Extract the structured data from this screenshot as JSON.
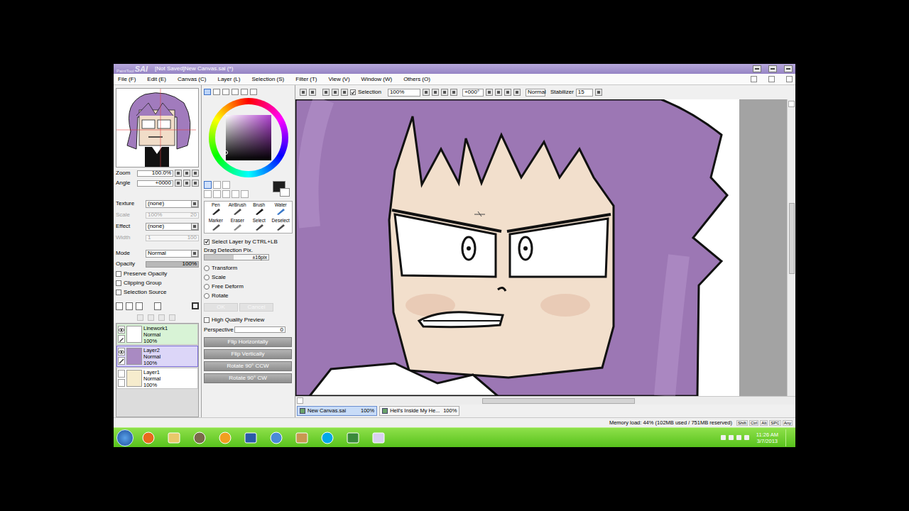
{
  "window": {
    "logo_small": "PaintTool",
    "logo_big": "SAI",
    "title": "[Not Saved]New Canvas.sai (*)"
  },
  "menu": [
    "File (F)",
    "Edit (E)",
    "Canvas (C)",
    "Layer (L)",
    "Selection (S)",
    "Filter (T)",
    "View (V)",
    "Window (W)",
    "Others (O)"
  ],
  "navigator": {
    "zoom": {
      "label": "Zoom",
      "value": "100.0%"
    },
    "angle": {
      "label": "Angle",
      "value": "+0000"
    }
  },
  "brush_settings": [
    {
      "label": "Texture",
      "value": "(none)",
      "extra": "",
      "disabled": false,
      "kind": "select"
    },
    {
      "label": "Scale",
      "value": "100%",
      "extra": "20",
      "disabled": true,
      "kind": "slider"
    },
    {
      "label": "Effect",
      "value": "(none)",
      "extra": "",
      "disabled": false,
      "kind": "select"
    },
    {
      "label": "Width",
      "value": "1",
      "extra": "100",
      "disabled": true,
      "kind": "slider"
    }
  ],
  "mode": {
    "label": "Mode",
    "value": "Normal"
  },
  "opacity": {
    "label": "Opacity",
    "value": "100%",
    "level": 1
  },
  "layer_options": [
    {
      "label": "Preserve Opacity",
      "checked": false
    },
    {
      "label": "Clipping Group",
      "checked": false
    },
    {
      "label": "Selection Source",
      "checked": false
    }
  ],
  "layers": [
    {
      "name": "Linework1",
      "mode": "Normal",
      "opacity": "100%",
      "visible": true,
      "selected": false,
      "kind": "linework"
    },
    {
      "name": "Layer2",
      "mode": "Normal",
      "opacity": "100%",
      "visible": true,
      "selected": true,
      "kind": "normal"
    },
    {
      "name": "Layer1",
      "mode": "Normal",
      "opacity": "100%",
      "visible": false,
      "selected": false,
      "kind": "normal"
    }
  ],
  "tools": [
    {
      "label": "Pen"
    },
    {
      "label": "AirBrush"
    },
    {
      "label": "Brush"
    },
    {
      "label": "Water"
    },
    {
      "label": "Marker"
    },
    {
      "label": "Eraser"
    },
    {
      "label": "Select"
    },
    {
      "label": "Deselect"
    }
  ],
  "transform": {
    "select_layer": {
      "label": "Select Layer by CTRL+LB",
      "checked": true
    },
    "drag": {
      "label": "Drag Detection Pix.",
      "value": "±16pix",
      "level": 0.45
    },
    "modes": [
      {
        "label": "Transform",
        "selected": false
      },
      {
        "label": "Scale",
        "selected": false
      },
      {
        "label": "Free Deform",
        "selected": false
      },
      {
        "label": "Rotate",
        "selected": false
      }
    ],
    "confirm": [
      {
        "label": "OK",
        "disabled": true
      },
      {
        "label": "Cancel",
        "disabled": true
      }
    ],
    "high_quality": {
      "label": "High Quality Preview",
      "checked": false
    },
    "perspective": {
      "label": "Perspective",
      "value": "0"
    },
    "actions": [
      "Flip Horizontally",
      "Flip Vertically",
      "Rotate 90° CCW",
      "Rotate 90° CW"
    ]
  },
  "toolbar": {
    "selection": {
      "label": "Selection",
      "checked": true
    },
    "zoom": "100%",
    "angle": "+000°",
    "mode": "Normal",
    "stabilizer": {
      "label": "Stabilizer",
      "value": "15"
    }
  },
  "canvas_tabs": [
    {
      "label": "New Canvas.sai",
      "zoom": "100%",
      "selected": true
    },
    {
      "label": "Hell's Inside My He...",
      "zoom": "100%",
      "selected": false
    }
  ],
  "status_bar": {
    "memory": "Memory load: 44% (102MB used / 751MB reserved)",
    "keys": [
      "Shift",
      "Ctrl",
      "Alt",
      "SPC",
      "Any"
    ]
  },
  "taskbar": {
    "time": "11:26 AM",
    "date": "3/7/2013"
  }
}
